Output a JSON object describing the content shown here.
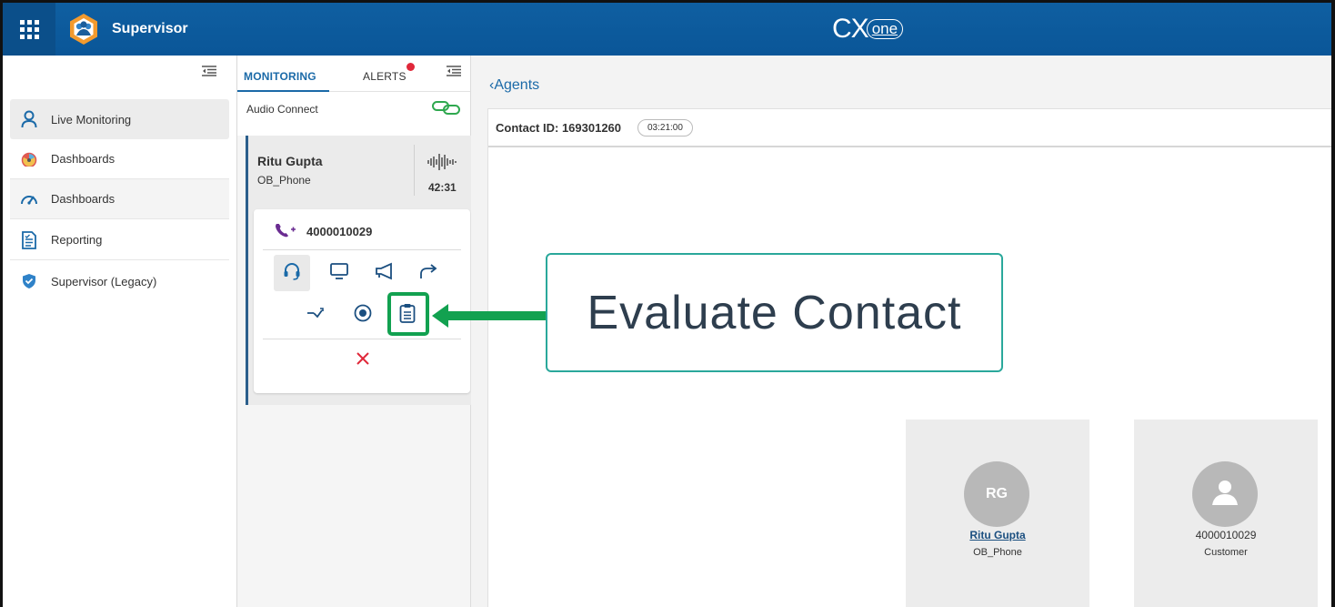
{
  "header": {
    "app_title": "Supervisor",
    "brand_cx": "CX",
    "brand_one": "one"
  },
  "sidebar": {
    "items": [
      {
        "label": "Live Monitoring",
        "icon": "person-outline-icon"
      },
      {
        "label": "Dashboards",
        "icon": "dashboard-gauge-color-icon"
      },
      {
        "label": "Dashboards",
        "icon": "speedometer-icon"
      },
      {
        "label": "Reporting",
        "icon": "report-document-icon"
      },
      {
        "label": "Supervisor (Legacy)",
        "icon": "shield-icon"
      }
    ]
  },
  "monitoring": {
    "tabs": [
      {
        "label": "MONITORING"
      },
      {
        "label": "ALERTS"
      }
    ],
    "audio_connect_label": "Audio Connect",
    "agent": {
      "name": "Ritu Gupta",
      "skill": "OB_Phone",
      "duration": "42:31",
      "phone": "4000010029"
    }
  },
  "main": {
    "back_label": "Agents",
    "contact_id_label": "Contact ID: 169301260",
    "contact_time": "03:21:00",
    "agent_tile": {
      "initials": "RG",
      "name": "Ritu Gupta",
      "skill": "OB_Phone"
    },
    "customer_tile": {
      "number": "4000010029",
      "label": "Customer"
    }
  },
  "callout": {
    "text": "Evaluate Contact"
  },
  "colors": {
    "header_blue": "#0f5fa1",
    "highlight_green": "#12a150",
    "callout_teal": "#2aa89b",
    "link_blue": "#1b6aa8",
    "close_red": "#e0283a"
  }
}
